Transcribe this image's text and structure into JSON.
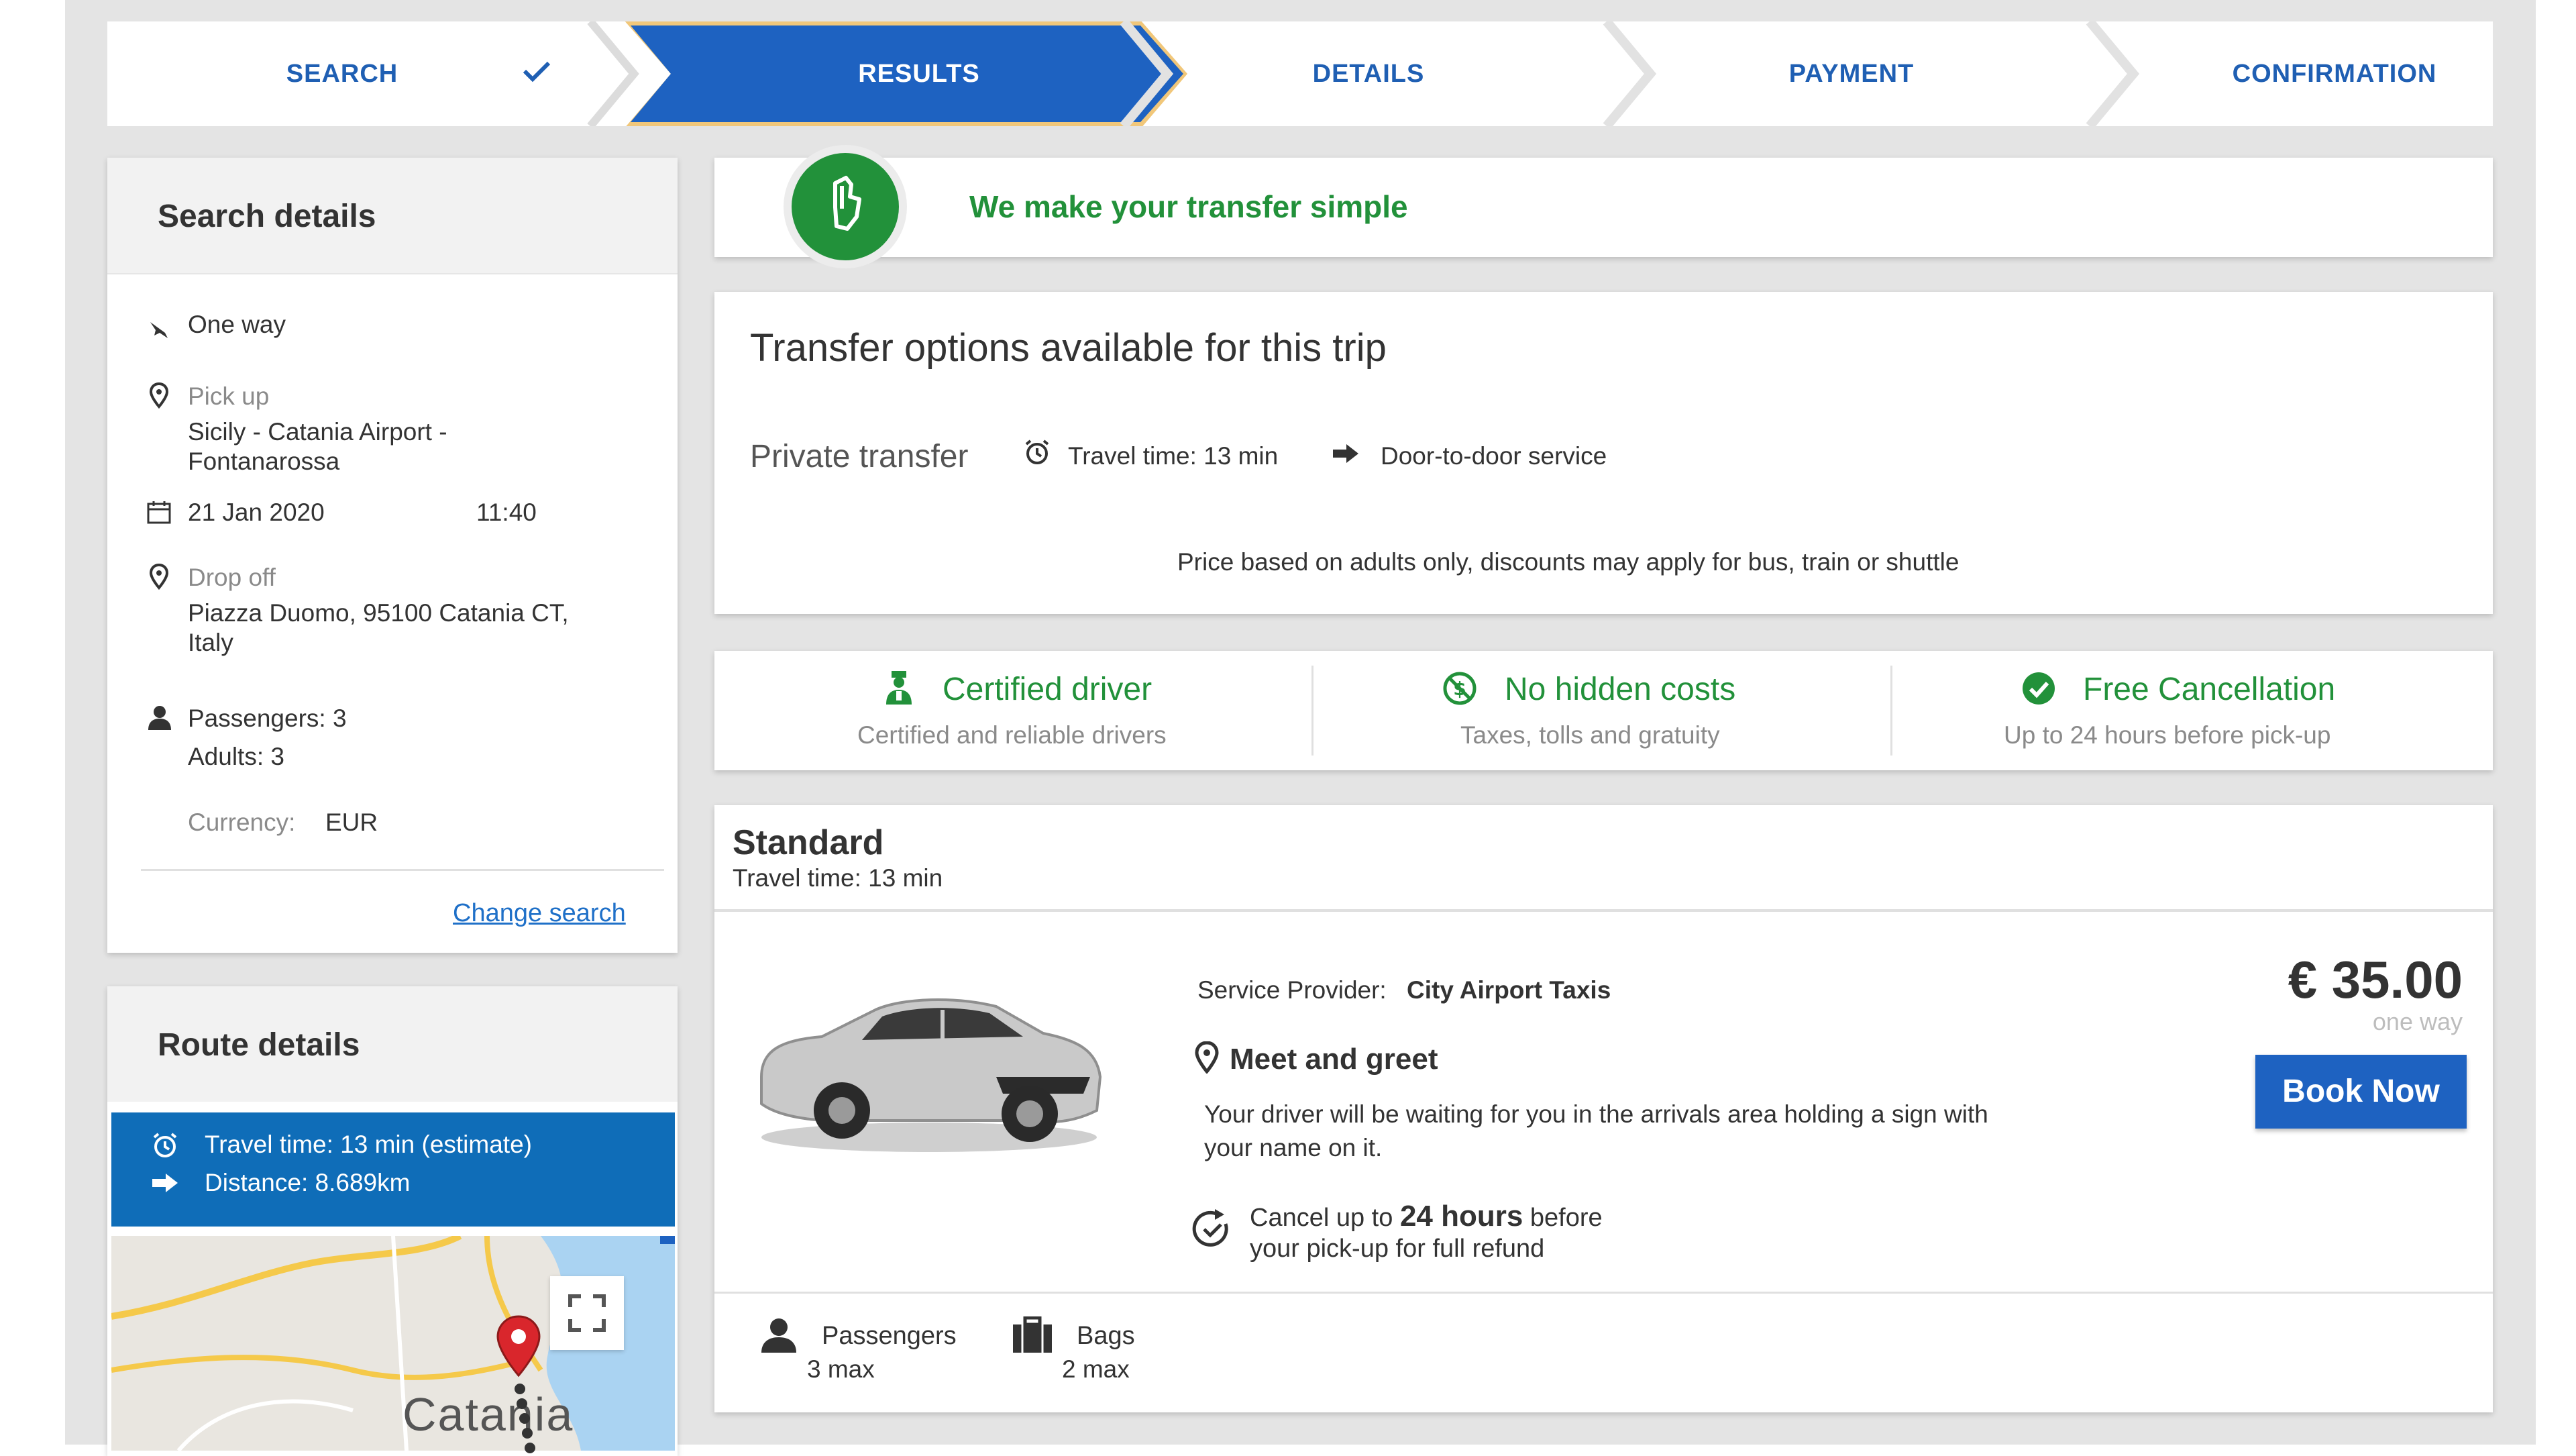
{
  "steps": [
    {
      "label": "SEARCH",
      "state": "done"
    },
    {
      "label": "RESULTS",
      "state": "active"
    },
    {
      "label": "DETAILS",
      "state": "pending"
    },
    {
      "label": "PAYMENT",
      "state": "pending"
    },
    {
      "label": "CONFIRMATION",
      "state": "pending"
    }
  ],
  "search_details": {
    "title": "Search details",
    "trip_type": "One way",
    "pickup_label": "Pick up",
    "pickup_line1": "Sicily - Catania Airport -",
    "pickup_line2": "Fontanarossa",
    "date": "21 Jan 2020",
    "time": "11:40",
    "dropoff_label": "Drop off",
    "dropoff_line1": "Piazza Duomo, 95100 Catania CT,",
    "dropoff_line2": "Italy",
    "passengers": "Passengers: 3",
    "adults": "Adults: 3",
    "currency_label": "Currency:",
    "currency_value": "EUR",
    "change_search": "Change search"
  },
  "route_details": {
    "title": "Route details",
    "travel_time": "Travel time: 13 min (estimate)",
    "distance": "Distance: 8.689km",
    "map_city": "Catania"
  },
  "banner": {
    "tagline": "We make your transfer simple"
  },
  "options": {
    "title": "Transfer options available for this trip",
    "type": "Private transfer",
    "travel_time": "Travel time: 13 min",
    "service": "Door-to-door service",
    "note": "Price based on adults only, discounts may apply for bus, train or shuttle"
  },
  "features": [
    {
      "title": "Certified driver",
      "sub": "Certified and reliable drivers",
      "icon": "driver-icon"
    },
    {
      "title": "No hidden costs",
      "sub": "Taxes, tolls and gratuity",
      "icon": "no-hidden-costs-icon"
    },
    {
      "title": "Free Cancellation",
      "sub": "Up to 24 hours before pick-up",
      "icon": "check-circle-icon"
    }
  ],
  "offer": {
    "title": "Standard",
    "travel_time": "Travel time: 13 min",
    "provider_label": "Service Provider:",
    "provider_name": "City Airport Taxis",
    "meet_title": "Meet and greet",
    "meet_line1": "Your driver will be waiting for you in the arrivals area holding a sign with",
    "meet_line2": "your name on it.",
    "cancel_pre": "Cancel up to",
    "cancel_bold": "24 hours",
    "cancel_post": "before",
    "cancel_line2": "your pick-up for full refund",
    "price": "€ 35.00",
    "price_sub": "one way",
    "book_label": "Book Now",
    "passengers_label": "Passengers",
    "passengers_max": "3 max",
    "bags_label": "Bags",
    "bags_max": "2 max"
  },
  "colors": {
    "primary_blue": "#1e62c1",
    "green": "#22913a",
    "route_blue": "#0f6db8"
  }
}
